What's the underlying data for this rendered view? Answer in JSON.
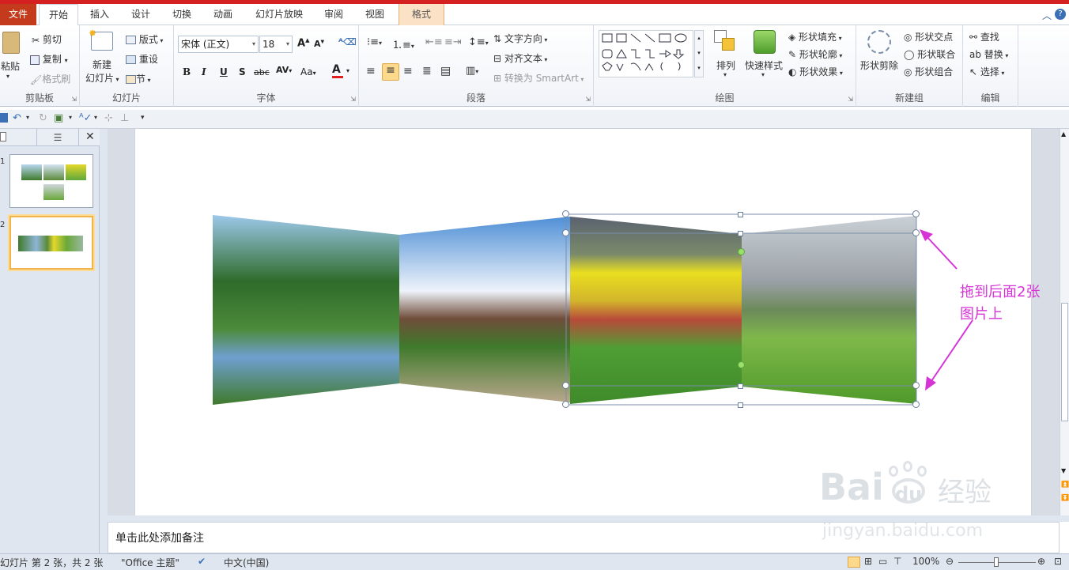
{
  "tabs": {
    "file": "文件",
    "home": "开始",
    "insert": "插入",
    "design": "设计",
    "transitions": "切换",
    "animations": "动画",
    "slideshow": "幻灯片放映",
    "review": "审阅",
    "view": "视图",
    "format": "格式"
  },
  "clipboard": {
    "paste": "粘贴",
    "cut": "剪切",
    "copy": "复制",
    "format_painter": "格式刷",
    "label": "剪贴板"
  },
  "slides": {
    "new_slide_1": "新建",
    "new_slide_2": "幻灯片",
    "layout": "版式",
    "reset": "重设",
    "section": "节",
    "label": "幻灯片"
  },
  "font": {
    "name": "宋体 (正文)",
    "size": "18",
    "label": "字体"
  },
  "paragraph": {
    "text_direction": "文字方向",
    "align_text": "对齐文本",
    "convert_smartart": "转换为 SmartArt",
    "label": "段落"
  },
  "drawing": {
    "arrange": "排列",
    "quick_styles": "快速样式",
    "shape_fill": "形状填充",
    "shape_outline": "形状轮廓",
    "shape_effects": "形状效果",
    "label": "绘图"
  },
  "newgroup": {
    "shape_cut": "形状剪除",
    "shape_intersect": "形状交点",
    "shape_union": "形状联合",
    "shape_combine": "形状组合",
    "label": "新建组"
  },
  "editing": {
    "find": "查找",
    "replace": "替换",
    "select": "选择",
    "label": "编辑"
  },
  "thumbnails": [
    {
      "number": "1"
    },
    {
      "number": "2"
    }
  ],
  "notes_placeholder": "单击此处添加备注",
  "annotation": {
    "line1": "拖到后面2张",
    "line2": "图片上"
  },
  "watermark": {
    "brand": "Bai",
    "du": "du",
    "jingyan": "经验",
    "url": "jingyan.baidu.com"
  },
  "status": {
    "slide_info": "幻灯片 第 2 张，共 2 张",
    "theme": "\"Office 主题\"",
    "language": "中文(中国)",
    "zoom": "100%"
  },
  "colors": {
    "accent_pink": "#d633d6",
    "file_tab": "#c43a1c",
    "top_bar": "#d42020"
  }
}
